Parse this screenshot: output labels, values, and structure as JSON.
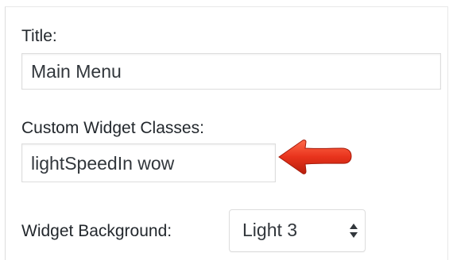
{
  "form": {
    "title_label": "Title:",
    "title_value": "Main Menu",
    "classes_label": "Custom Widget Classes:",
    "classes_value": "lightSpeedIn wow",
    "background_label": "Widget Background:",
    "background_value": "Light 3"
  },
  "icons": {
    "annotation_arrow": "red-arrow-icon",
    "select_arrows": "up-down-chevron-icon"
  },
  "colors": {
    "arrow": "#e8331c",
    "text": "#23282d",
    "border": "#dddddd"
  }
}
